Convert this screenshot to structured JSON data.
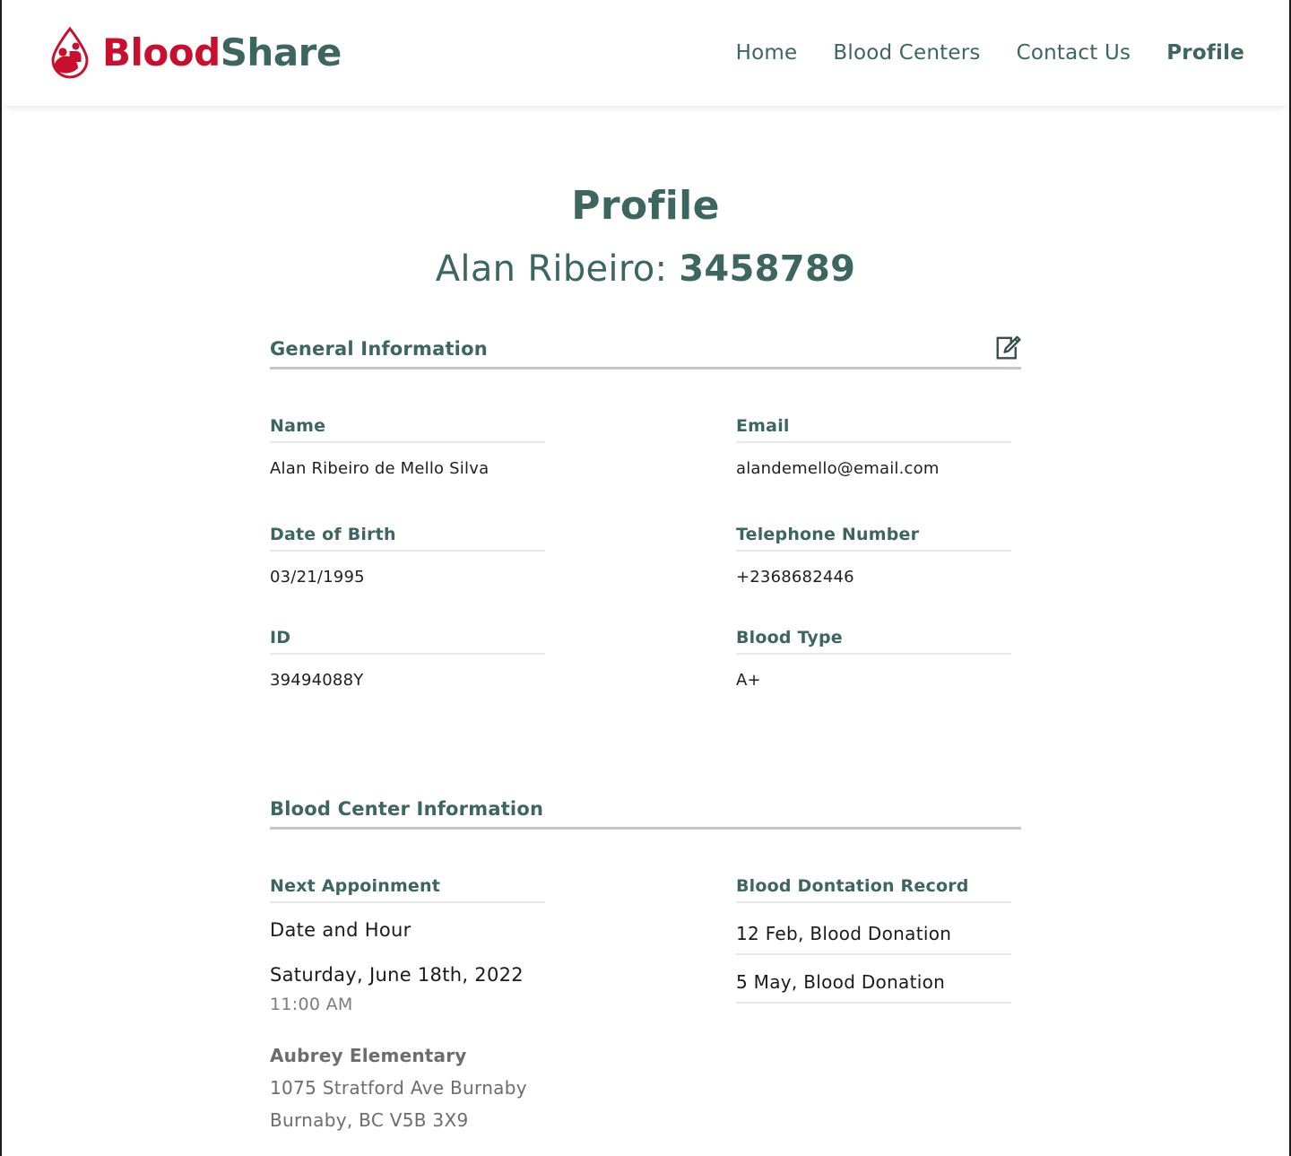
{
  "brand": {
    "name_primary": "Blood",
    "name_secondary": "Share",
    "logo_icon": "blood-drop-people-icon",
    "primary_color": "#c8102e",
    "secondary_color": "#3d6660"
  },
  "nav": {
    "items": [
      {
        "label": "Home",
        "active": false
      },
      {
        "label": "Blood Centers",
        "active": false
      },
      {
        "label": "Contact Us",
        "active": false
      },
      {
        "label": "Profile",
        "active": true
      }
    ]
  },
  "header": {
    "title": "Profile",
    "subject_name": "Alan Ribeiro: ",
    "subject_id": "3458789"
  },
  "general_information": {
    "section_title": "General Information",
    "edit_icon": "edit-pencil-square-icon",
    "fields": [
      {
        "label": "Name",
        "value": "Alan Ribeiro de Mello Silva"
      },
      {
        "label": "Email",
        "value": "alandemello@email.com"
      },
      {
        "label": "Date of Birth",
        "value": "03/21/1995"
      },
      {
        "label": "Telephone Number",
        "value": "+2368682446"
      },
      {
        "label": "ID",
        "value": "39494088Y"
      },
      {
        "label": "Blood Type",
        "value": "A+"
      }
    ]
  },
  "blood_center_information": {
    "section_title": "Blood Center Information",
    "appointment": {
      "label": "Next Appoinment",
      "subtitle": "Date and Hour",
      "date": "Saturday, June 18th, 2022",
      "time": "11:00 AM",
      "center_name": "Aubrey Elementary",
      "address_line_1": "1075 Stratford Ave Burnaby",
      "address_line_2": "Burnaby, BC V5B 3X9"
    },
    "donation_record": {
      "label": "Blood Dontation Record",
      "items": [
        "12 Feb, Blood Donation",
        "5 May, Blood Donation"
      ]
    }
  }
}
